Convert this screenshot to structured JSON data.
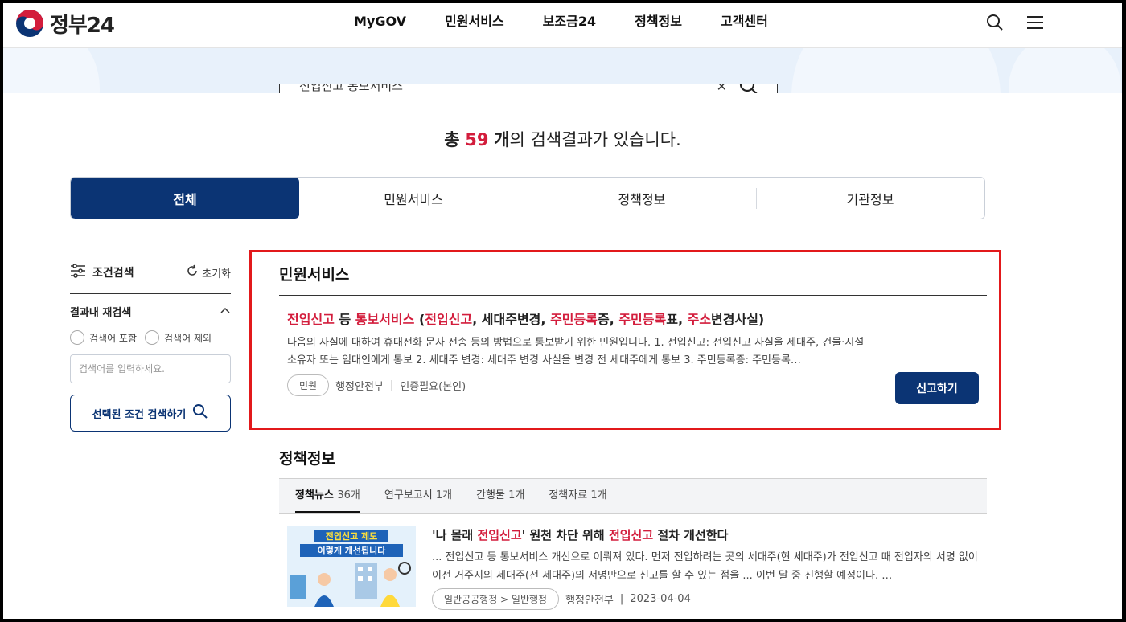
{
  "header": {
    "logo_text": "정부24",
    "nav": [
      "MyGOV",
      "민원서비스",
      "보조금24",
      "정책정보",
      "고객센터"
    ]
  },
  "search": {
    "value": "전입신고 통보서비스"
  },
  "result": {
    "prefix": "총",
    "count": "59",
    "unit": "개",
    "suffix": "의 검색결과가 있습니다."
  },
  "tabs": [
    "전체",
    "민원서비스",
    "정책정보",
    "기관정보"
  ],
  "sidebar": {
    "title": "조건검색",
    "reset": "초기화",
    "refine_title": "결과내 재검색",
    "radio_include": "검색어 포함",
    "radio_exclude": "검색어 제외",
    "input_placeholder": "검색어를 입력하세요.",
    "search_button": "선택된 조건 검색하기"
  },
  "civil": {
    "section_title": "민원서비스",
    "item": {
      "title_parts": [
        {
          "t": "전입신고",
          "hl": true
        },
        {
          "t": " 등 ",
          "hl": false
        },
        {
          "t": "통보서비스",
          "hl": true
        },
        {
          "t": " (",
          "hl": false
        },
        {
          "t": "전입신고",
          "hl": true
        },
        {
          "t": ", 세대주변경, ",
          "hl": false
        },
        {
          "t": "주민등록",
          "hl": true
        },
        {
          "t": "증, ",
          "hl": false
        },
        {
          "t": "주민등록",
          "hl": true
        },
        {
          "t": "표, ",
          "hl": false
        },
        {
          "t": "주소",
          "hl": true
        },
        {
          "t": "변경사실)",
          "hl": false
        }
      ],
      "description": "다음의 사실에 대하여 휴대전화 문자 전송 등의 방법으로 통보받기 위한 민원입니다. 1. 전입신고: 전입신고 사실을 세대주, 건물·시설 소유자 또는 임대인에게 통보 2. 세대주 변경: 세대주 변경 사실을 변경 전 세대주에게 통보 3. 주민등록증: 주민등록…",
      "badge": "민원",
      "agency": "행정안전부",
      "auth": "인증필요(본인)",
      "button": "신고하기"
    }
  },
  "policy": {
    "section_title": "정책정보",
    "subtabs": [
      {
        "label": "정책뉴스",
        "count": "36개"
      },
      {
        "label": "연구보고서",
        "count": "1개"
      },
      {
        "label": "간행물",
        "count": "1개"
      },
      {
        "label": "정책자료",
        "count": "1개"
      }
    ],
    "news": {
      "thumb_line1": "전입신고 제도",
      "thumb_line2": "이렇게 개선됩니다",
      "title_parts": [
        {
          "t": "'나 몰래 ",
          "hl": false
        },
        {
          "t": "전입신고",
          "hl": true
        },
        {
          "t": "' 원천 차단 위해 ",
          "hl": false
        },
        {
          "t": "전입신고",
          "hl": true
        },
        {
          "t": " 절차 개선한다",
          "hl": false
        }
      ],
      "description": "... 전입신고 등 통보서비스 개선으로 이뤄져 있다. 먼저 전입하려는 곳의 세대주(현 세대주)가 전입신고 때 전입자의 서명 없이 이전 거주지의 세대주(전 세대주)의 서명만으로 신고를 할 수 있는 점을 ... 이번 달 중 진행할 예정이다. …",
      "category": "일반공공행정 > 일반행정",
      "agency": "행정안전부",
      "date": "2023-04-04"
    }
  },
  "colors": {
    "primary": "#0b3474",
    "highlight": "#d31d3c",
    "callout": "#e2191b"
  }
}
